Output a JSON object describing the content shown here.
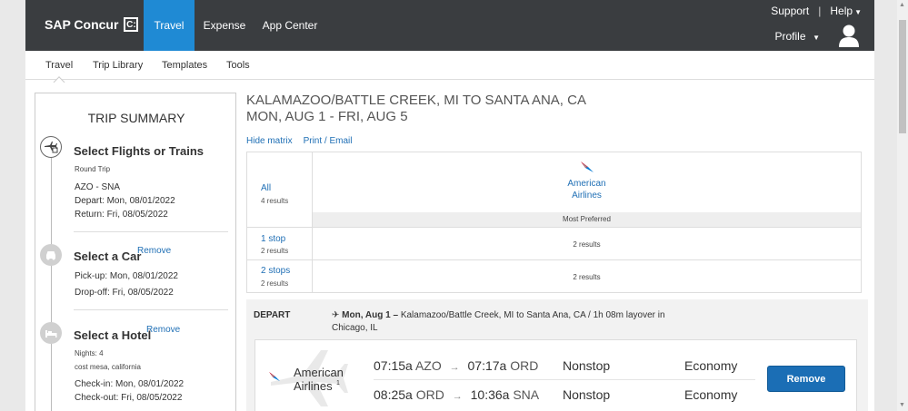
{
  "header": {
    "logo_text": "SAP Concur",
    "logo_mark": "C:",
    "nav": [
      "Travel",
      "Expense",
      "App Center"
    ],
    "support": "Support",
    "separator": "|",
    "help": "Help",
    "profile": "Profile"
  },
  "subnav": [
    "Travel",
    "Trip Library",
    "Templates",
    "Tools"
  ],
  "trip_summary": {
    "title": "TRIP SUMMARY",
    "flights": {
      "title": "Select Flights or Trains",
      "trip_type": "Round Trip",
      "route": "AZO - SNA",
      "depart": "Depart: Mon, 08/01/2022",
      "return": "Return: Fri, 08/05/2022"
    },
    "car": {
      "title": "Select a Car",
      "remove": "Remove",
      "pickup": "Pick-up: Mon, 08/01/2022",
      "dropoff": "Drop-off: Fri, 08/05/2022"
    },
    "hotel": {
      "title": "Select a Hotel",
      "remove": "Remove",
      "nights": "Nights: 4",
      "location": "cost mesa, california",
      "checkin": "Check-in: Mon, 08/01/2022",
      "checkout": "Check-out: Fri, 08/05/2022"
    }
  },
  "main": {
    "route_line1": "KALAMAZOO/BATTLE CREEK, MI TO SANTA ANA, CA",
    "route_line2": "MON, AUG 1 - FRI, AUG 5",
    "hide_matrix": "Hide matrix",
    "print_email": "Print / Email"
  },
  "matrix": {
    "all": {
      "label": "All",
      "count": "4 results"
    },
    "airline": "American Airlines",
    "preferred": "Most Preferred",
    "rows": [
      {
        "label": "1 stop",
        "count": "2 results",
        "result": "2 results"
      },
      {
        "label": "2 stops",
        "count": "2 results",
        "result": "2 results"
      }
    ]
  },
  "depart": {
    "label": "DEPART",
    "date": "Mon, Aug 1",
    "dash": "–",
    "info": "Kalamazoo/Battle Creek, MI to Santa Ana, CA  / 1h 08m layover in Chicago, IL"
  },
  "flight": {
    "airline": "American Airlines",
    "footnote": "1",
    "segments": [
      {
        "dep_time": "07:15a",
        "dep": "AZO",
        "arr_time": "07:17a",
        "arr": "ORD",
        "stops": "Nonstop",
        "cabin": "Economy"
      },
      {
        "dep_time": "08:25a",
        "dep": "ORD",
        "arr_time": "10:36a",
        "arr": "SNA",
        "stops": "Nonstop",
        "cabin": "Economy"
      }
    ],
    "arrow": "→",
    "remove": "Remove"
  },
  "colors": {
    "header_bg": "#3a3d40",
    "accent": "#1f8ad4",
    "link": "#1f6fb5",
    "button": "#1b6eb5"
  }
}
